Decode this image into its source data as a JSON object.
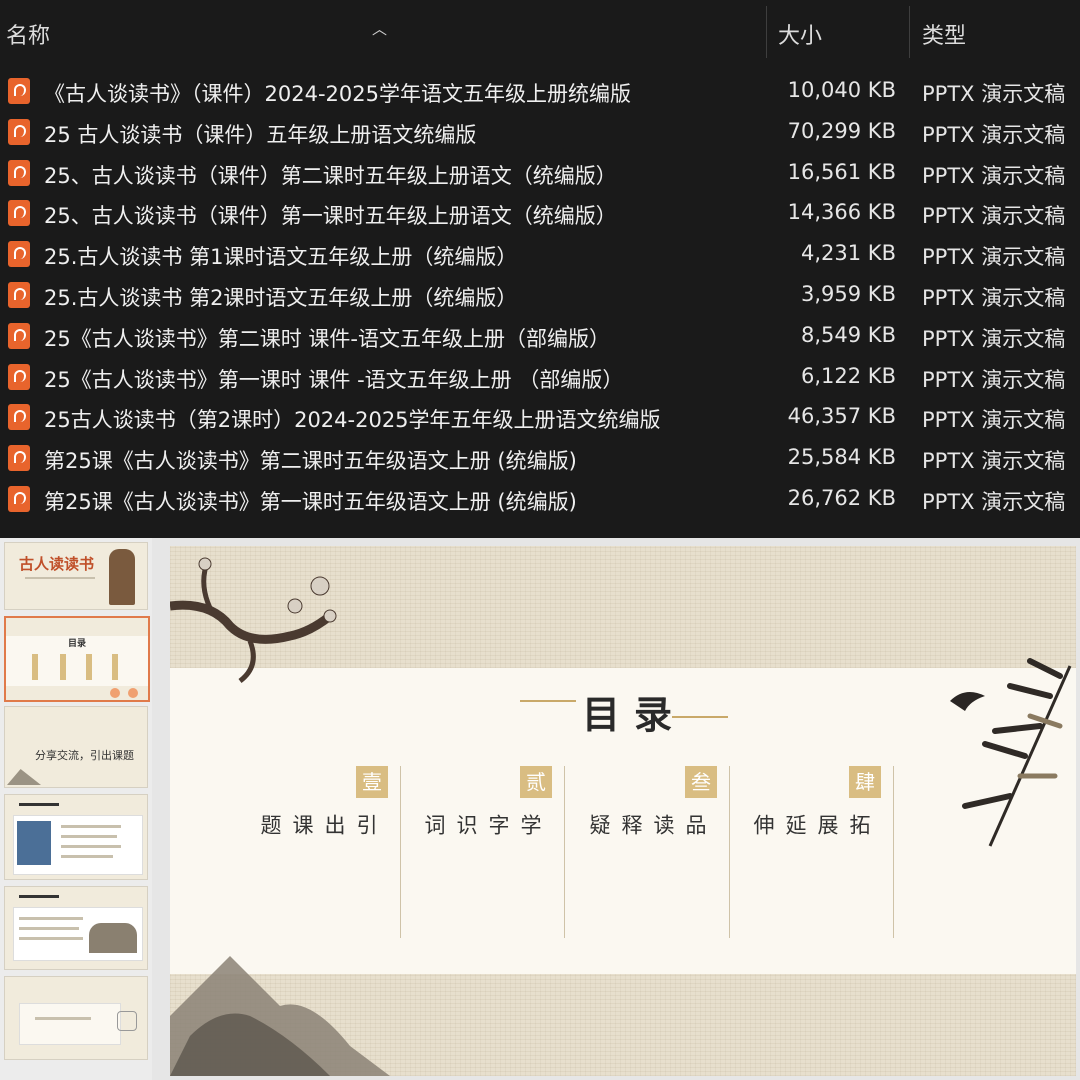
{
  "explorer": {
    "columns": {
      "name": "名称",
      "size": "大小",
      "type": "类型"
    },
    "files": [
      {
        "name": "《古人谈读书》（课件）2024-2025学年语文五年级上册统编版",
        "size": "10,040 KB",
        "type": "PPTX 演示文稿"
      },
      {
        "name": "25 古人谈读书（课件）五年级上册语文统编版",
        "size": "70,299 KB",
        "type": "PPTX 演示文稿"
      },
      {
        "name": "25、古人谈读书（课件）第二课时五年级上册语文（统编版）",
        "size": "16,561 KB",
        "type": "PPTX 演示文稿"
      },
      {
        "name": "25、古人谈读书（课件）第一课时五年级上册语文（统编版）",
        "size": "14,366 KB",
        "type": "PPTX 演示文稿"
      },
      {
        "name": "25.古人谈读书 第1课时语文五年级上册（统编版）",
        "size": "4,231 KB",
        "type": "PPTX 演示文稿"
      },
      {
        "name": "25.古人谈读书 第2课时语文五年级上册（统编版）",
        "size": "3,959 KB",
        "type": "PPTX 演示文稿"
      },
      {
        "name": "25《古人谈读书》第二课时 课件-语文五年级上册（部编版）",
        "size": "8,549 KB",
        "type": "PPTX 演示文稿"
      },
      {
        "name": "25《古人谈读书》第一课时 课件 -语文五年级上册 （部编版）",
        "size": "6,122 KB",
        "type": "PPTX 演示文稿"
      },
      {
        "name": "25古人谈读书（第2课时）2024-2025学年五年级上册语文统编版",
        "size": "46,357 KB",
        "type": "PPTX 演示文稿"
      },
      {
        "name": "第25课《古人谈读书》第二课时五年级语文上册 (统编版)",
        "size": "25,584 KB",
        "type": "PPTX 演示文稿"
      },
      {
        "name": "第25课《古人谈读书》第一课时五年级语文上册 (统编版)",
        "size": "26,762 KB",
        "type": "PPTX 演示文稿"
      }
    ]
  },
  "thumbnails": {
    "t1_title": "古人读读书",
    "t3_text": "分享交流，引出课题"
  },
  "slide": {
    "title": "目录",
    "items": [
      {
        "badge": "壹",
        "text": "引出课题"
      },
      {
        "badge": "贰",
        "text": "学字识词"
      },
      {
        "badge": "叁",
        "text": "品读释疑"
      },
      {
        "badge": "肆",
        "text": "拓展延伸"
      }
    ]
  },
  "colors": {
    "file_icon": "#e8642c",
    "badge": "#d9bd82",
    "accent_line": "#c9a969"
  }
}
